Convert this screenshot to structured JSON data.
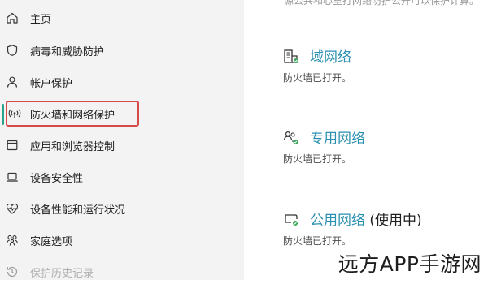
{
  "sidebar": {
    "items": [
      {
        "label": "主页",
        "icon": "home-icon"
      },
      {
        "label": "病毒和威胁防护",
        "icon": "shield-icon"
      },
      {
        "label": "帐户保护",
        "icon": "person-icon"
      },
      {
        "label": "防火墙和网络保护",
        "icon": "wifi-broadcast-icon"
      },
      {
        "label": "应用和浏览器控制",
        "icon": "app-window-icon"
      },
      {
        "label": "设备安全性",
        "icon": "laptop-icon"
      },
      {
        "label": "设备性能和运行状况",
        "icon": "heart-pulse-icon"
      },
      {
        "label": "家庭选项",
        "icon": "family-icon"
      },
      {
        "label": "保护历史记录",
        "icon": "history-icon"
      }
    ]
  },
  "main": {
    "top_text": "源公共和心室打网络防护公开可以保护计算。",
    "networks": [
      {
        "title": "域网络",
        "suffix": "",
        "status": "防火墙已打开。",
        "icon": "domain-network-icon"
      },
      {
        "title": "专用网络",
        "suffix": "",
        "status": "防火墙已打开。",
        "icon": "private-network-icon"
      },
      {
        "title": "公用网络",
        "suffix": " (使用中)",
        "status": "防火墙已打开。",
        "icon": "public-network-icon"
      }
    ]
  },
  "watermark": "远方APP手游网",
  "colors": {
    "accent": "#2aa38c",
    "link": "#2a8fb0",
    "highlight": "#d84a4a",
    "sidebar_bg": "#f3f3f3"
  }
}
